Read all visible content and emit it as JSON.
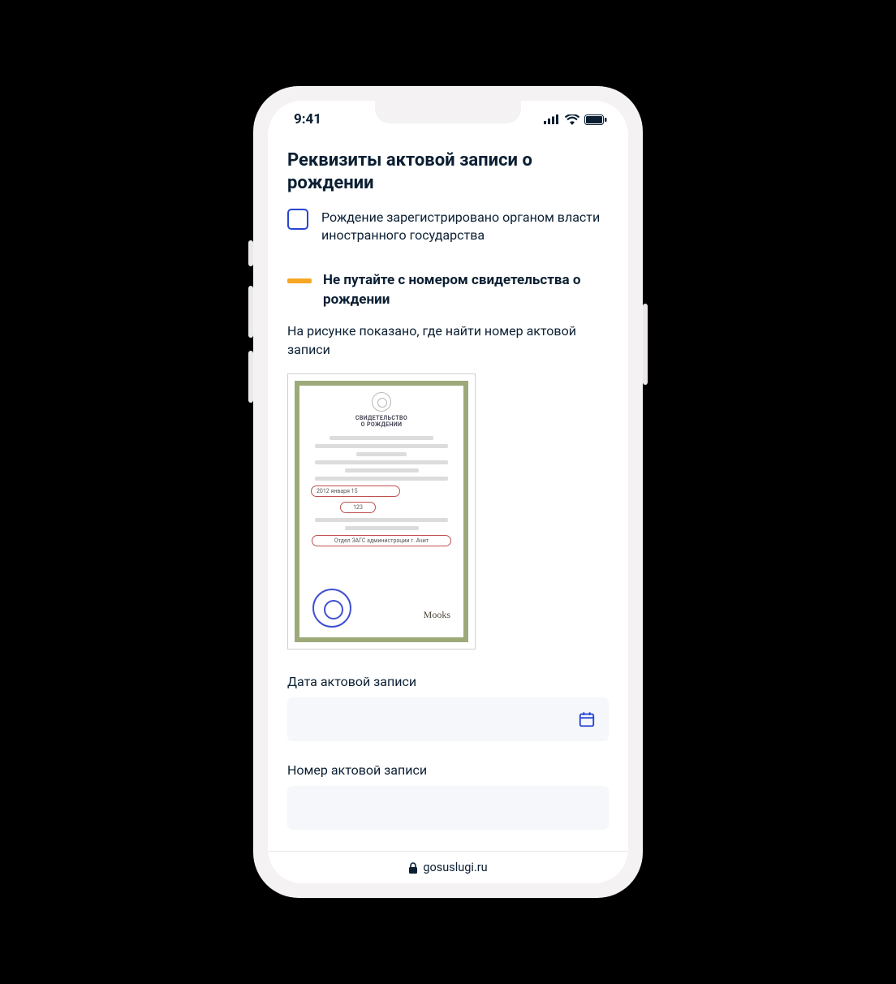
{
  "status": {
    "time": "9:41"
  },
  "page": {
    "title": "Реквизиты актовой записи о рождении",
    "checkbox_label": "Рождение зарегистрировано органом власти иностранного государства",
    "warn_title": "Не путайте с номером свидетельства о рождении",
    "hint": "На рисунке показано, где найти номер актовой записи"
  },
  "cert": {
    "title_line1": "СВИДЕТЕЛЬСТВО",
    "title_line2": "О РОЖДЕНИИ",
    "date": "2012   января   15",
    "number": "123",
    "dept": "Отдел ЗАГС администрации г. Ачит",
    "signature": "Mooks"
  },
  "form": {
    "date_label": "Дата актовой записи",
    "number_label": "Номер актовой записи"
  },
  "url": "gosuslugi.ru"
}
